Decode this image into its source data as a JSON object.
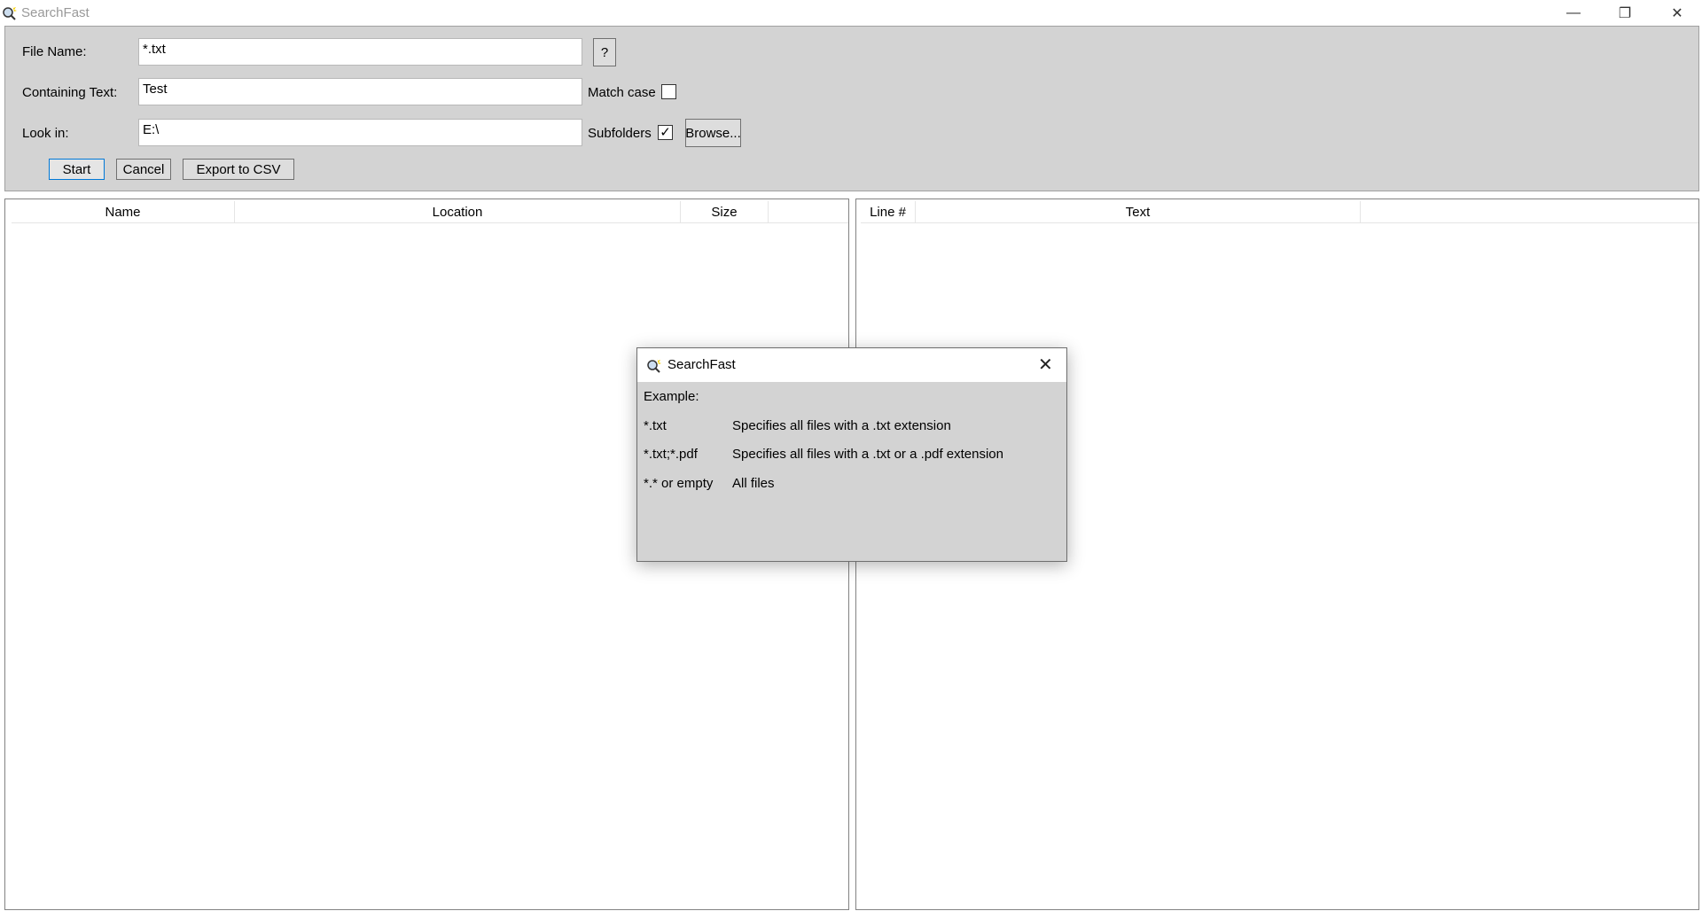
{
  "window": {
    "title": "SearchFast",
    "minimize_icon": "minimize-icon",
    "restore_icon": "restore-icon",
    "close_icon": "close-icon"
  },
  "form": {
    "file_name_label": "File Name:",
    "file_name_value": "*.txt",
    "help_button": "?",
    "containing_text_label": "Containing Text:",
    "containing_text_value": "Test",
    "match_case_label": "Match case",
    "match_case_checked": false,
    "look_in_label": "Look in:",
    "look_in_value": "E:\\",
    "subfolders_label": "Subfolders",
    "subfolders_checked": true,
    "subfolders_check": "✓",
    "browse_button": "Browse...",
    "start_button": "Start",
    "cancel_button": "Cancel",
    "export_button": "Export to CSV"
  },
  "files_table": {
    "columns": [
      "Name",
      "Location",
      "Size"
    ]
  },
  "lines_table": {
    "columns": [
      "Line #",
      "Text"
    ]
  },
  "dialog": {
    "title": "SearchFast",
    "heading": "Example:",
    "rows": [
      {
        "pattern": "*.txt",
        "description": "Specifies all files with a .txt extension"
      },
      {
        "pattern": "*.txt;*.pdf",
        "description": "Specifies all files with a .txt or a .pdf extension"
      },
      {
        "pattern": "*.* or empty",
        "description": "All files"
      }
    ]
  }
}
